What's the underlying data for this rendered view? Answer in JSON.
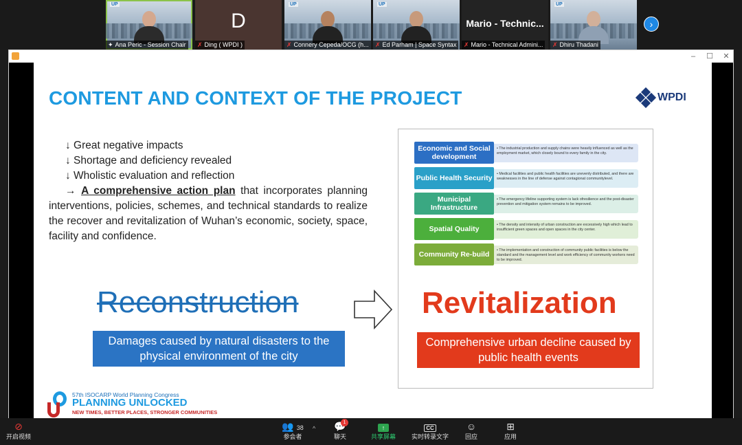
{
  "participants": [
    {
      "name": "Ana Peric - Session Chair",
      "pinned": true,
      "muted": false
    },
    {
      "name": "Ding ( WPDI )",
      "initial": "D",
      "muted": true
    },
    {
      "name": "Connery Cepeda/OCG (h...",
      "muted": true
    },
    {
      "name": "Ed Parham | Space Syntax",
      "muted": true
    },
    {
      "name": "Mario - Technical Admini...",
      "big_name": "Mario - Technic...",
      "muted": true
    },
    {
      "name": "Dhiru Thadani",
      "muted": true
    }
  ],
  "next_page_icon": "chevron-right-icon",
  "window": {
    "minimize": "–",
    "maximize": "☐",
    "close": "✕"
  },
  "slide": {
    "title": "CONTENT AND CONTEXT OF THE PROJECT",
    "logo_text": "WPDI",
    "bullets": [
      "↓ Great negative impacts",
      "↓ Shortage and deficiency revealed",
      "↓ Wholistic evaluation and reflection"
    ],
    "plan_arrow": "→",
    "plan_bold": "A comprehensive action plan",
    "plan_rest": " that incorporates planning interventions, policies, schemes, and technical standards to realize the recover and revitalization of Wuhan’s economic, society, space, facility and confidence.",
    "left_heading": "Reconstruction",
    "left_box": "Damages caused by natural disasters to the physical environment of the city",
    "right_heading": "Revitalization",
    "right_box": "Comprehensive urban decline caused by public health events",
    "rows": [
      {
        "label": "Economic and Social development",
        "color": "#2c6fc4",
        "bg": "#dde6f5",
        "desc": "• The industrial production and supply chains were heavily influenced as well as the employment market, which closely bound to every family in the city."
      },
      {
        "label": "Public Health Security",
        "color": "#2aa0c8",
        "bg": "#dcedf4",
        "desc": "• Medical facilities and public health facilities are unevenly distributed, and there are weaknesses in the line of defense against contagionat communitylevel."
      },
      {
        "label": "Municipal Infrastructure",
        "color": "#3aa882",
        "bg": "#dcefe7",
        "desc": "• The emergency lifeline supporting system is lack ofresilience and the post-disaster prevention and mitigation system remains to be improved."
      },
      {
        "label": "Spatial Quality",
        "color": "#4caf3c",
        "bg": "#e0efd8",
        "desc": "• The density and intensity of urban construction are excessively high which lead to insufficient green spaces and open spaces in the city center."
      },
      {
        "label": "Community Re-build",
        "color": "#7cac3a",
        "bg": "#e5ecd9",
        "desc": "• The implementation and construction of community public facilities is below the standard and the management level and work efficiency of community workers need to be improved."
      }
    ],
    "footer": {
      "line1": "57th ISOCARP World Planning Congress",
      "line2": "PLANNING UNLOCKED",
      "line3": "NEW TIMES, BETTER PLACES, STRONGER COMMUNITIES"
    }
  },
  "toolbar": {
    "video": "开启视频",
    "participants": "参会者",
    "participants_count": "38",
    "chat": "聊天",
    "chat_badge": "1",
    "share": "共享屏幕",
    "captions": "实时转录文字",
    "captions_icon_text": "CC",
    "reactions": "回应",
    "apps": "应用"
  }
}
